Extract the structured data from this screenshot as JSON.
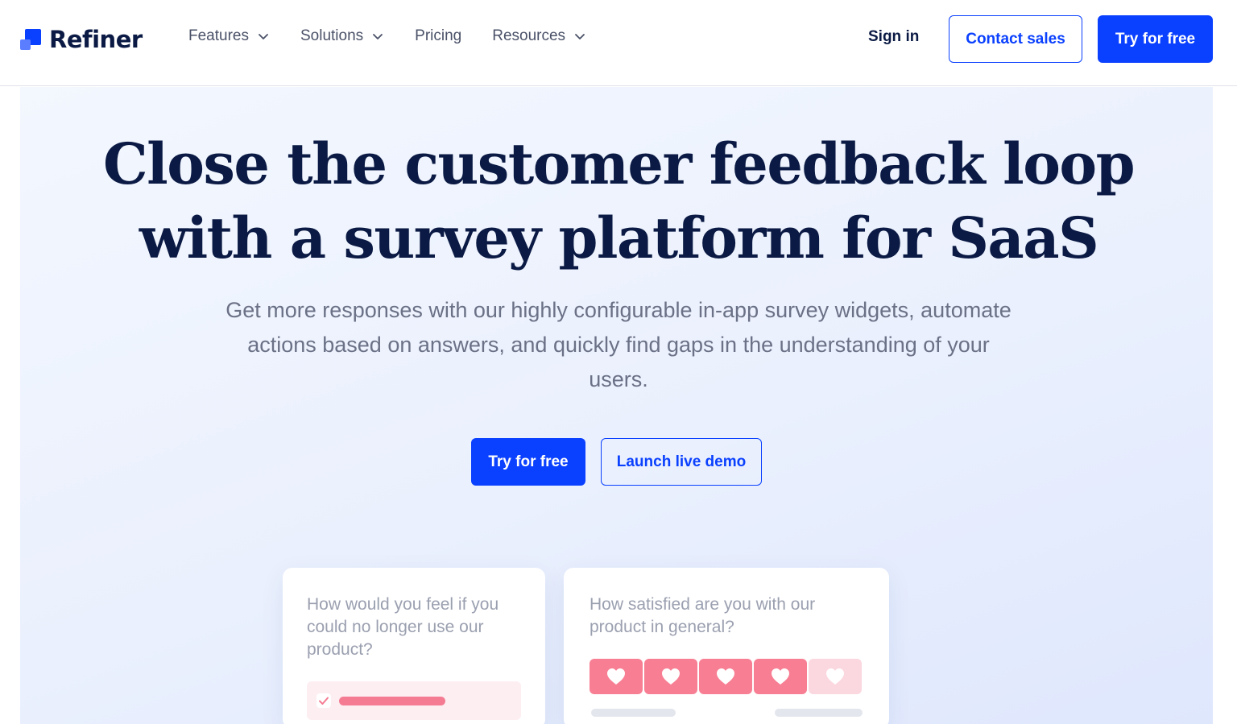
{
  "brand": {
    "name": "Refiner",
    "primary_color": "#0a40ff",
    "text_color": "#0b1a44"
  },
  "nav": {
    "items": [
      {
        "label": "Features",
        "has_dropdown": true
      },
      {
        "label": "Solutions",
        "has_dropdown": true
      },
      {
        "label": "Pricing",
        "has_dropdown": false
      },
      {
        "label": "Resources",
        "has_dropdown": true
      }
    ],
    "sign_in": "Sign in",
    "contact_sales": "Contact sales",
    "try_free": "Try for free"
  },
  "hero": {
    "headline_line1": "Close the customer feedback loop",
    "headline_line2": "with a survey platform for SaaS",
    "subhead": "Get more responses with our highly configurable in-app survey widgets, automate actions based on answers, and quickly find gaps in the understanding of your users.",
    "cta_primary": "Try for free",
    "cta_secondary": "Launch live demo"
  },
  "cards": {
    "card1": {
      "question": "How would you feel if you could no longer use our product?"
    },
    "card2": {
      "question": "How satisfied are you with our product in general?",
      "rating_selected": 4,
      "rating_max": 5,
      "heart_color": "#f77e93",
      "heart_empty_color": "#fbd7df"
    }
  }
}
